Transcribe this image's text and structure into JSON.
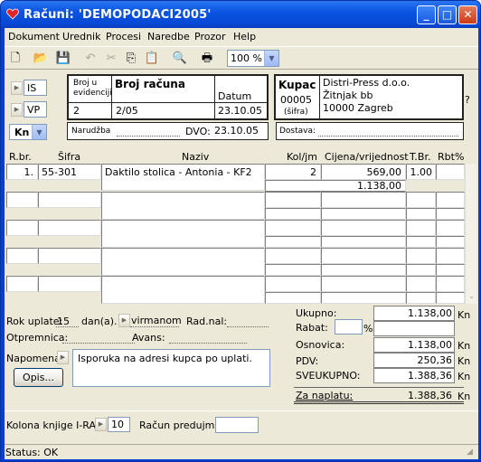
{
  "window": {
    "title": "Računi: 'DEMOPODACI2005'",
    "min": "_",
    "max": "□",
    "close": "✕"
  },
  "menu": [
    "Dokument",
    "Urednik",
    "Procesi",
    "Naredbe",
    "Prozor",
    "Help"
  ],
  "toolbar": {
    "zoom": "100 %"
  },
  "doc": {
    "type_code": "IS",
    "sub_code": "VP",
    "currency": "Kn",
    "broj_evid_label": "Broj u evidenciji",
    "broj_evid": "2",
    "broj_racuna_label": "Broj računa",
    "broj_racuna": "2/05",
    "datum_label": "Datum",
    "datum": "23.10.05",
    "narudzba_label": "Narudžba",
    "narudzba": "",
    "dvo_label": "DVO:",
    "dvo": "23.10.05",
    "kupac_label": "Kupac",
    "kupac_sifra": "00005",
    "sifra_label": "(šifra)",
    "kupac_name": "Distri-Press d.o.o.",
    "kupac_street": "Žitnjak bb",
    "kupac_city": "10000 Zagreb",
    "question": "?",
    "dostava_label": "Dostava:",
    "dostava": ""
  },
  "grid": {
    "headers": {
      "rbr": "R.br.",
      "sifra": "Šifra",
      "naziv": "Naziv",
      "kol": "Kol/jm",
      "cijena": "Cijena/vrijednost",
      "tbr": "T.Br.",
      "rbt": "Rbt%"
    },
    "rows": [
      {
        "rbr": "1.",
        "sifra": "55-301",
        "naziv": "Daktilo stolica - Antonia - KF2",
        "kol": "2",
        "cijena": "569,00",
        "tbr": "1.00",
        "rbt": "",
        "vrijednost": "1.138,00"
      }
    ]
  },
  "footer": {
    "rok_label": "Rok uplate:",
    "rok": "15",
    "dan_label": "dan(a).",
    "nacin": "virmanom",
    "radnal_label": "Rad.nal:",
    "radnal": "",
    "otpremnica_label": "Otpremnica:",
    "otpremnica": "",
    "avans_label": "Avans:",
    "avans": "",
    "napomena_label": "Napomena:",
    "napomena": "Isporuka na adresi kupca po uplati.",
    "opis_button": "Opis...",
    "ukupno_label": "Ukupno:",
    "ukupno": "1.138,00",
    "rabat_label": "Rabat:",
    "rabat_pct": "",
    "pct": "%",
    "rabat": "",
    "osnovica_label": "Osnovica:",
    "osnovica": "1.138,00",
    "pdv_label": "PDV:",
    "pdv": "250,36",
    "sveukupno_label": "SVEUKUPNO:",
    "sveukupno": "1.388,36",
    "zanaplatu_label": "Za naplatu:",
    "zanaplatu": "1.388,36",
    "kn": "Kn",
    "kolona_label": "Kolona knjige I-RA:",
    "kolona": "10",
    "predujam_label": "Račun predujma:",
    "predujam": ""
  },
  "status": "Status: OK"
}
